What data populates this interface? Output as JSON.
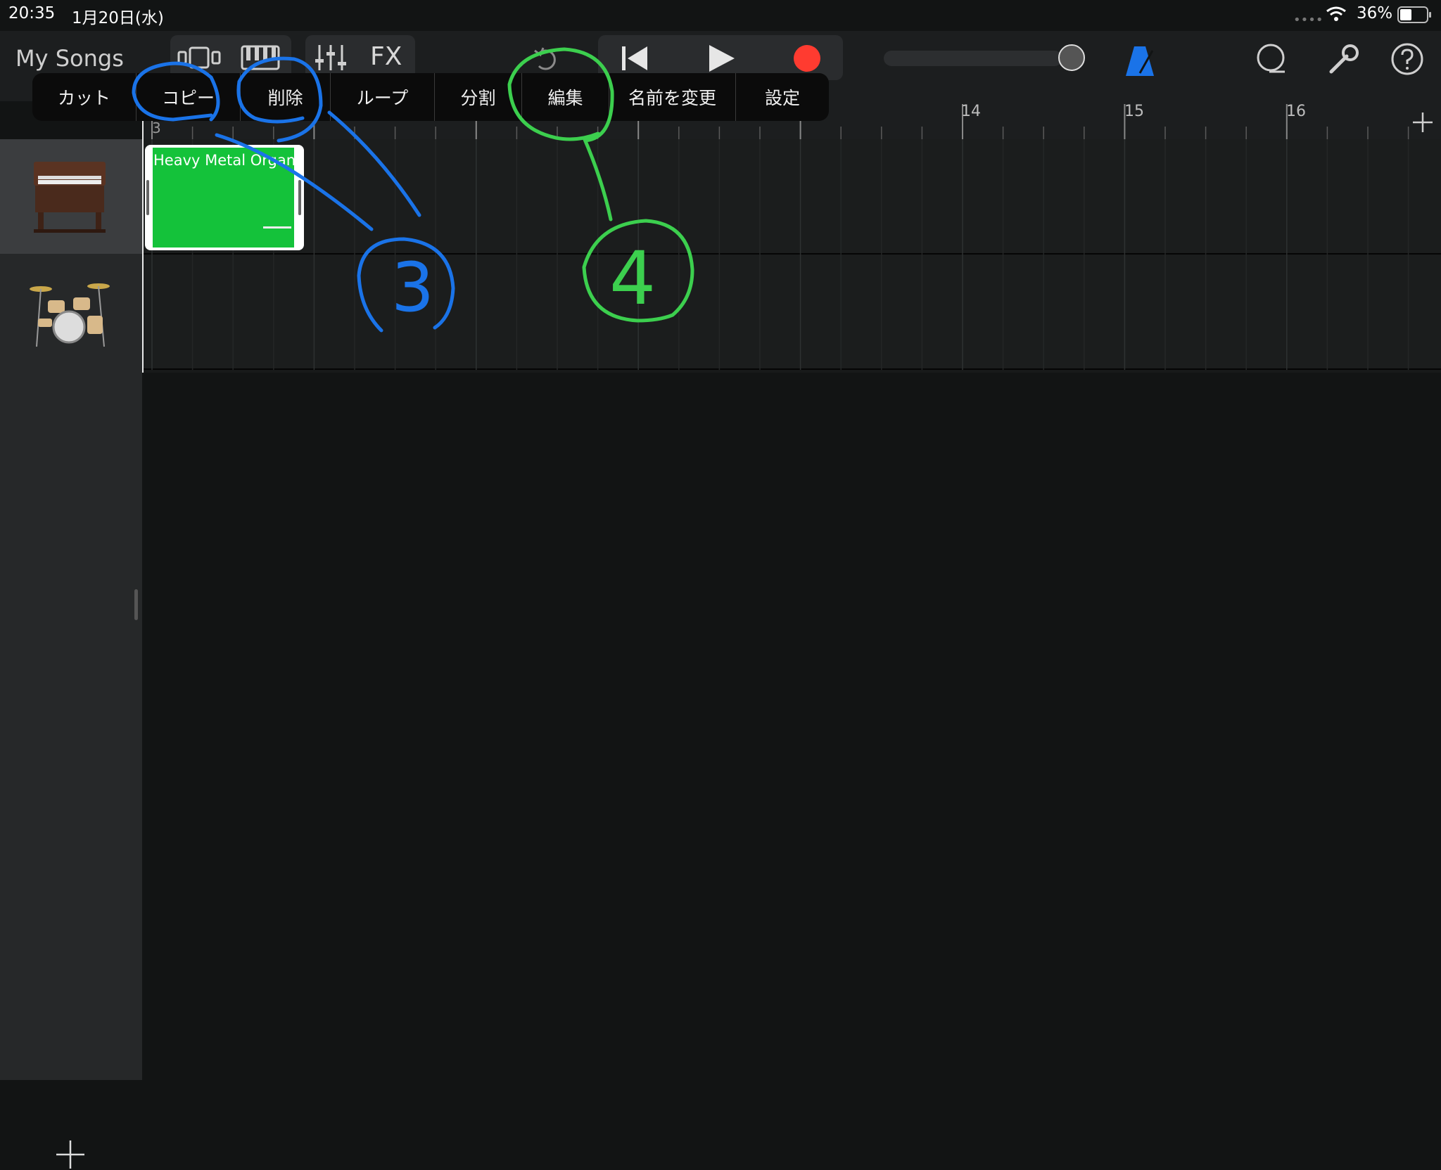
{
  "status_bar": {
    "time": "20:35",
    "date": "1月20日(水)",
    "battery": "36%"
  },
  "toolbar": {
    "back_label": "My Songs",
    "fx_label": "FX"
  },
  "context_menu": {
    "items": [
      {
        "label": "カット"
      },
      {
        "label": "コピー"
      },
      {
        "label": "削除"
      },
      {
        "label": "ループ"
      },
      {
        "label": "分割"
      },
      {
        "label": "編集"
      },
      {
        "label": "名前を変更"
      },
      {
        "label": "設定"
      }
    ]
  },
  "ruler": {
    "marks": [
      "3",
      "14",
      "15",
      "16"
    ]
  },
  "tracks": [
    {
      "instrument_icon": "organ-icon",
      "region_name": "Heavy Metal Organ"
    },
    {
      "instrument_icon": "drum-kit-icon"
    }
  ],
  "annotations": {
    "step_3": "3",
    "step_4": "4",
    "color_3": "#1a73e8",
    "color_4": "#3ccf4e"
  },
  "colors": {
    "region": "#14c23a",
    "record": "#ff3b30",
    "metronome": "#1a73e8"
  }
}
